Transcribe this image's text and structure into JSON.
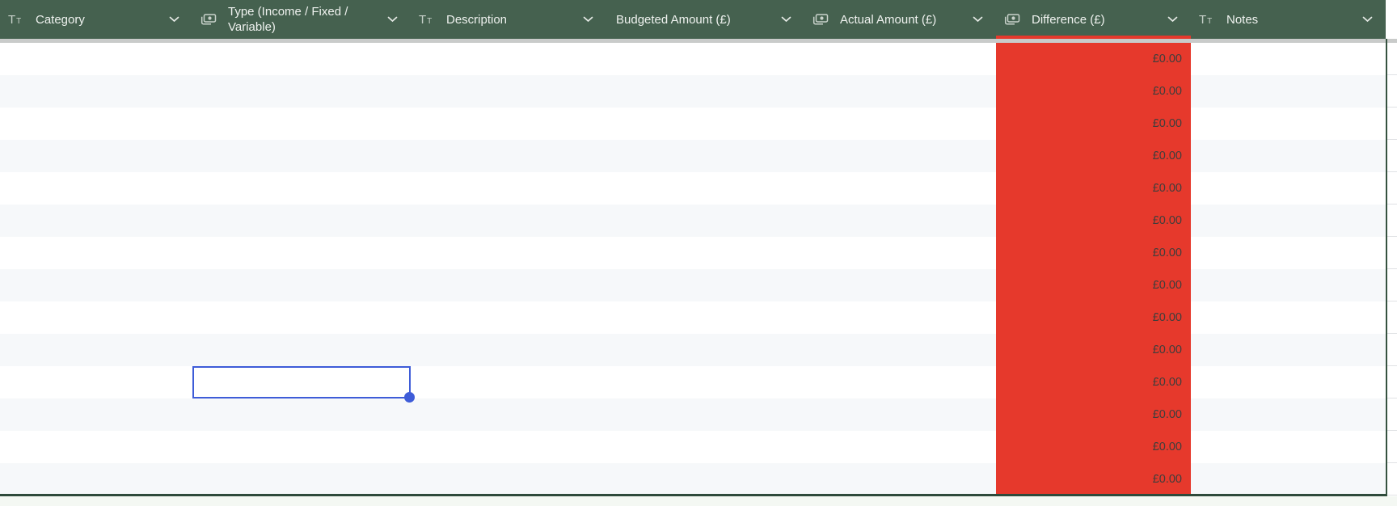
{
  "table": {
    "columns": [
      {
        "label": "Category",
        "type_icon": "text-field-icon"
      },
      {
        "label": "Type (Income / Fixed / Variable)",
        "type_icon": "currency-field-icon"
      },
      {
        "label": "Description",
        "type_icon": "text-field-icon"
      },
      {
        "label": "Budgeted Amount (£)",
        "type_icon": "none"
      },
      {
        "label": "Actual Amount (£)",
        "type_icon": "currency-field-icon"
      },
      {
        "label": "Difference (£)",
        "type_icon": "currency-field-icon"
      },
      {
        "label": "Notes",
        "type_icon": "text-field-icon"
      }
    ],
    "row_count": 14,
    "difference_values": [
      "£0.00",
      "£0.00",
      "£0.00",
      "£0.00",
      "£0.00",
      "£0.00",
      "£0.00",
      "£0.00",
      "£0.00",
      "£0.00",
      "£0.00",
      "£0.00",
      "£0.00",
      "£0.00"
    ],
    "selection": {
      "row_index": 11,
      "column_label": "Type (Income / Fixed / Variable)"
    }
  },
  "colors": {
    "header_green": "#45614F",
    "difference_red": "#E6392C",
    "selection_blue": "#3E5CD8",
    "row_stripe": "#F6F8FA",
    "frozen_shadow_gray": "#C9CBCA",
    "table_border_dark": "#2E4A3B"
  }
}
